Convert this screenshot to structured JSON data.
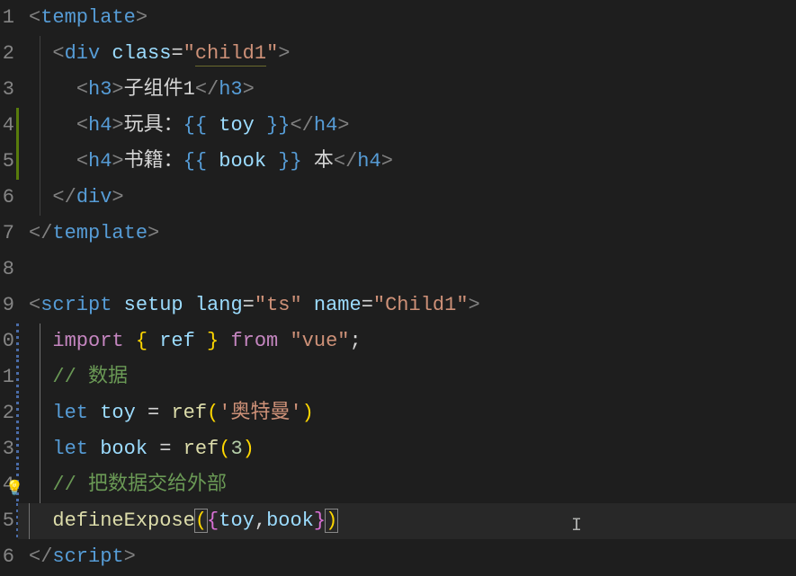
{
  "gutter": [
    "1",
    "2",
    "3",
    "4",
    "5",
    "6",
    "7",
    "8",
    "9",
    "0",
    "1",
    "2",
    "3",
    "4",
    "5",
    "6"
  ],
  "code": {
    "l1": {
      "open": "<",
      "tag": "template",
      "close": ">"
    },
    "l2": {
      "open": "<",
      "tag": "div",
      "sp": " ",
      "attr": "class",
      "eq": "=",
      "q": "\"",
      "val": "child1",
      "q2": "\"",
      "close": ">"
    },
    "l3": {
      "open": "<",
      "tag": "h3",
      "close": ">",
      "text": "子组件1",
      "open2": "</",
      "tag2": "h3",
      "close2": ">"
    },
    "l4": {
      "open": "<",
      "tag": "h4",
      "close": ">",
      "text": "玩具：",
      "dl": "{{",
      "sp": " ",
      "var": "toy",
      "sp2": " ",
      "dr": "}}",
      "open2": "</",
      "tag2": "h4",
      "close2": ">"
    },
    "l5": {
      "open": "<",
      "tag": "h4",
      "close": ">",
      "text": "书籍：",
      "dl": "{{",
      "sp": " ",
      "var": "book",
      "sp2": " ",
      "dr": "}}",
      "text2": " 本",
      "open2": "</",
      "tag2": "h4",
      "close2": ">"
    },
    "l6": {
      "open": "</",
      "tag": "div",
      "close": ">"
    },
    "l7": {
      "open": "</",
      "tag": "template",
      "close": ">"
    },
    "l9": {
      "open": "<",
      "tag": "script",
      "sp": " ",
      "a1": "setup",
      "sp2": " ",
      "a2": "lang",
      "eq": "=",
      "q": "\"",
      "v2": "ts",
      "q2": "\"",
      "sp3": " ",
      "a3": "name",
      "eq2": "=",
      "q3": "\"",
      "v3": "Child1",
      "q4": "\"",
      "close": ">"
    },
    "l10": {
      "kw": "import",
      "sp": " ",
      "by": "{",
      "sp2": " ",
      "var": "ref",
      "sp3": " ",
      "by2": "}",
      "sp4": " ",
      "from": "from",
      "sp5": " ",
      "str": "\"vue\"",
      "semi": ";"
    },
    "l11": {
      "cmt": "// 数据"
    },
    "l12": {
      "kw": "let",
      "sp": " ",
      "var": "toy",
      "sp2": " ",
      "eq": "=",
      "sp3": " ",
      "fn": "ref",
      "py": "(",
      "str": "'奥特曼'",
      "py2": ")"
    },
    "l13": {
      "kw": "let",
      "sp": " ",
      "var": "book",
      "sp2": " ",
      "eq": "=",
      "sp3": " ",
      "fn": "ref",
      "py": "(",
      "num": "3",
      "py2": ")"
    },
    "l14": {
      "cmt": "// 把数据交给外部"
    },
    "l15": {
      "fn": "defineExpose",
      "py": "(",
      "bp": "{",
      "v1": "toy",
      "c": ",",
      "v2": "book",
      "bp2": "}",
      "py2": ")"
    },
    "l16": {
      "open": "</",
      "tag": "script",
      "close": ">"
    }
  }
}
